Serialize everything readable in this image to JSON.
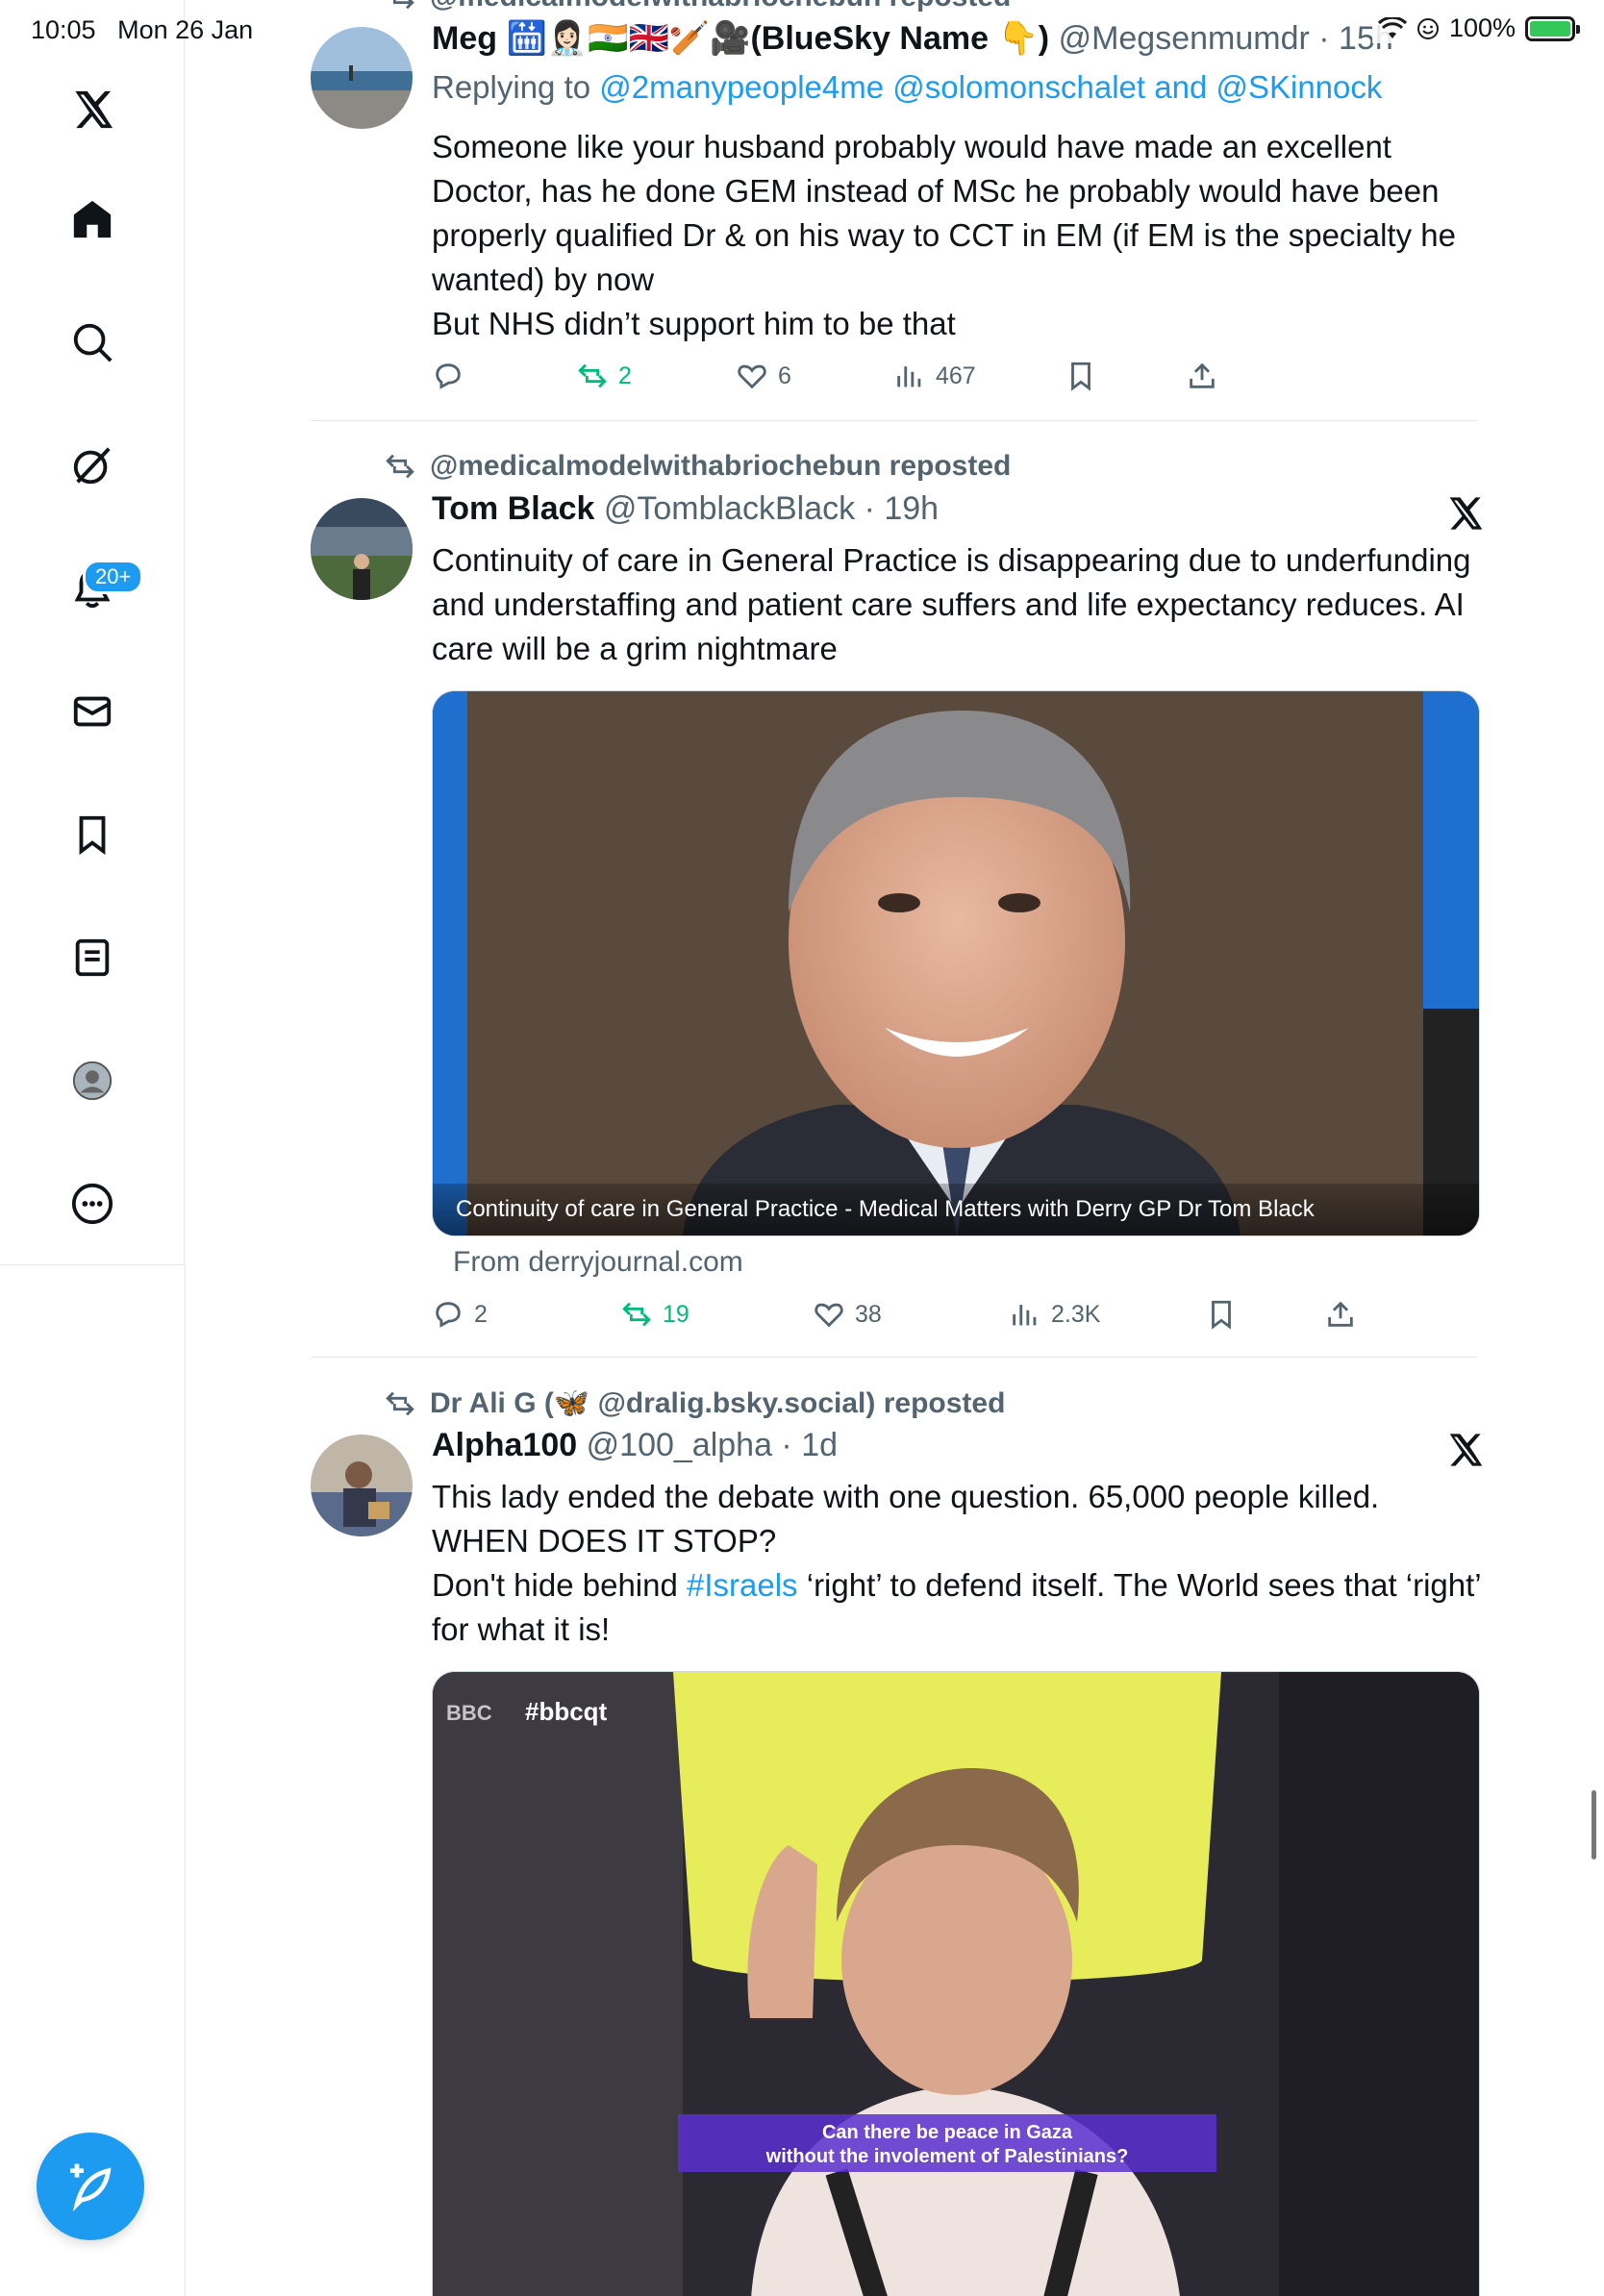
{
  "status": {
    "time": "10:05",
    "date": "Mon 26 Jan",
    "battery": "100%"
  },
  "sidebar": {
    "items": [
      {
        "name": "x-logo"
      },
      {
        "name": "home"
      },
      {
        "name": "search"
      },
      {
        "name": "grok"
      },
      {
        "name": "notifications",
        "badge": "20+"
      },
      {
        "name": "messages"
      },
      {
        "name": "bookmarks"
      },
      {
        "name": "lists"
      },
      {
        "name": "profile"
      },
      {
        "name": "more"
      }
    ],
    "compose": "compose-post"
  },
  "tweets": [
    {
      "reposted_by": "@medicalmodelwithabriochebun reposted",
      "name": "Meg 🛗👩🏻‍⚕️🇮🇳🇬🇧🏏🎥(BlueSky Name 👇)",
      "handle": "@Megsenmumdr · 15h",
      "replying_to_prefix": "Replying to ",
      "replying_to": "@2manypeople4me @solomonschalet and @SKinnock",
      "lines": [
        "Someone like your husband probably would have made an excellent Doctor, has he done GEM instead of MSc he probably would have been properly qualified Dr & on his way to CCT in EM (if EM is the specialty he wanted) by now",
        "But NHS didn’t support him to be that"
      ],
      "stats": {
        "replies": "",
        "reposts": "2",
        "likes": "6",
        "views": "467"
      }
    },
    {
      "reposted_by": "@medicalmodelwithabriochebun reposted",
      "name": "Tom Black",
      "handle": "@TomblackBlack · 19h",
      "text": "Continuity of care in General Practice is disappearing due to underfunding and understaffing and patient care suffers and life expectancy reduces. AI care will be a grim nightmare",
      "card_caption": "Continuity of care in General Practice - Medical Matters with Derry GP Dr Tom Black",
      "card_source": "From derryjournal.com",
      "stats": {
        "replies": "2",
        "reposts": "19",
        "likes": "38",
        "views": "2.3K"
      }
    },
    {
      "reposted_by": "Dr Ali G (🦋 @dralig.bsky.social) reposted",
      "name": "Alpha100",
      "handle": "@100_alpha · 1d",
      "line1": "This lady ended the debate with one question. 65,000 people killed. WHEN DOES IT STOP?",
      "line2_pre": "Don't hide behind ",
      "line2_tag": "#Israels",
      "line2_post": " ‘right’ to defend itself. The World sees that ‘right’ for what it is!",
      "video_tag": "#bbcqt",
      "video_logo": "BBC",
      "video_subtitle_1": "Can there be peace in Gaza",
      "video_subtitle_2": "without the involement of Palestinians?"
    }
  ]
}
